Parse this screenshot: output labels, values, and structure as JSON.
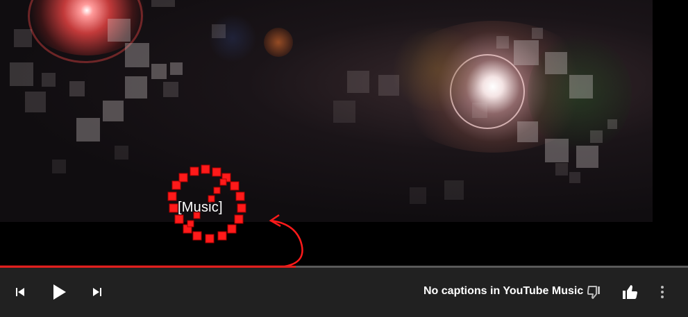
{
  "player": {
    "caption_text": "[Music]",
    "progress_fraction": 0.43,
    "status_text": "No captions in YouTube Music",
    "accent_color": "#e0201e",
    "annotation_color": "#ff1a1a"
  },
  "controls": {
    "previous_icon": "skip-previous-icon",
    "play_icon": "play-icon",
    "next_icon": "skip-next-icon",
    "dislike_icon": "thumbs-down-icon",
    "like_icon": "thumbs-up-icon",
    "more_icon": "more-vertical-icon"
  }
}
